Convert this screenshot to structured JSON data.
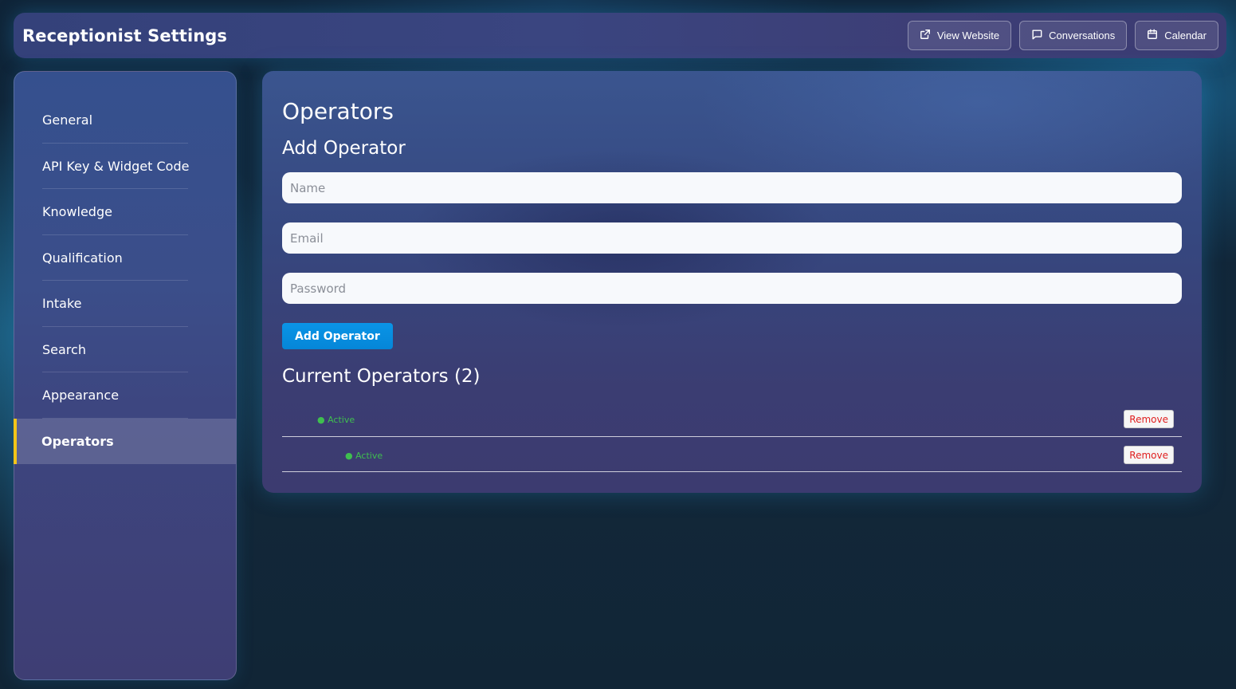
{
  "header": {
    "title": "Receptionist Settings",
    "actions": [
      {
        "label": "View Website",
        "icon": "external-link-icon"
      },
      {
        "label": "Conversations",
        "icon": "message-icon"
      },
      {
        "label": "Calendar",
        "icon": "calendar-icon"
      }
    ]
  },
  "sidebar": {
    "items": [
      {
        "label": "General"
      },
      {
        "label": "API Key & Widget Code"
      },
      {
        "label": "Knowledge"
      },
      {
        "label": "Qualification"
      },
      {
        "label": "Intake"
      },
      {
        "label": "Search"
      },
      {
        "label": "Appearance"
      },
      {
        "label": "Operators",
        "active": true
      }
    ],
    "active_accent": "#f5c518"
  },
  "main": {
    "title": "Operators",
    "add_section": {
      "title": "Add Operator",
      "name_placeholder": "Name",
      "email_placeholder": "Email",
      "password_placeholder": "Password",
      "submit_label": "Add Operator"
    },
    "current_section": {
      "title": "Current Operators (2)",
      "operators": [
        {
          "status": "● Active",
          "remove_label": "Remove"
        },
        {
          "status": "● Active",
          "remove_label": "Remove"
        }
      ]
    }
  },
  "colors": {
    "primary_button": "#0a94e6",
    "status_active": "#3fbf4f",
    "remove_text": "#e02020"
  }
}
